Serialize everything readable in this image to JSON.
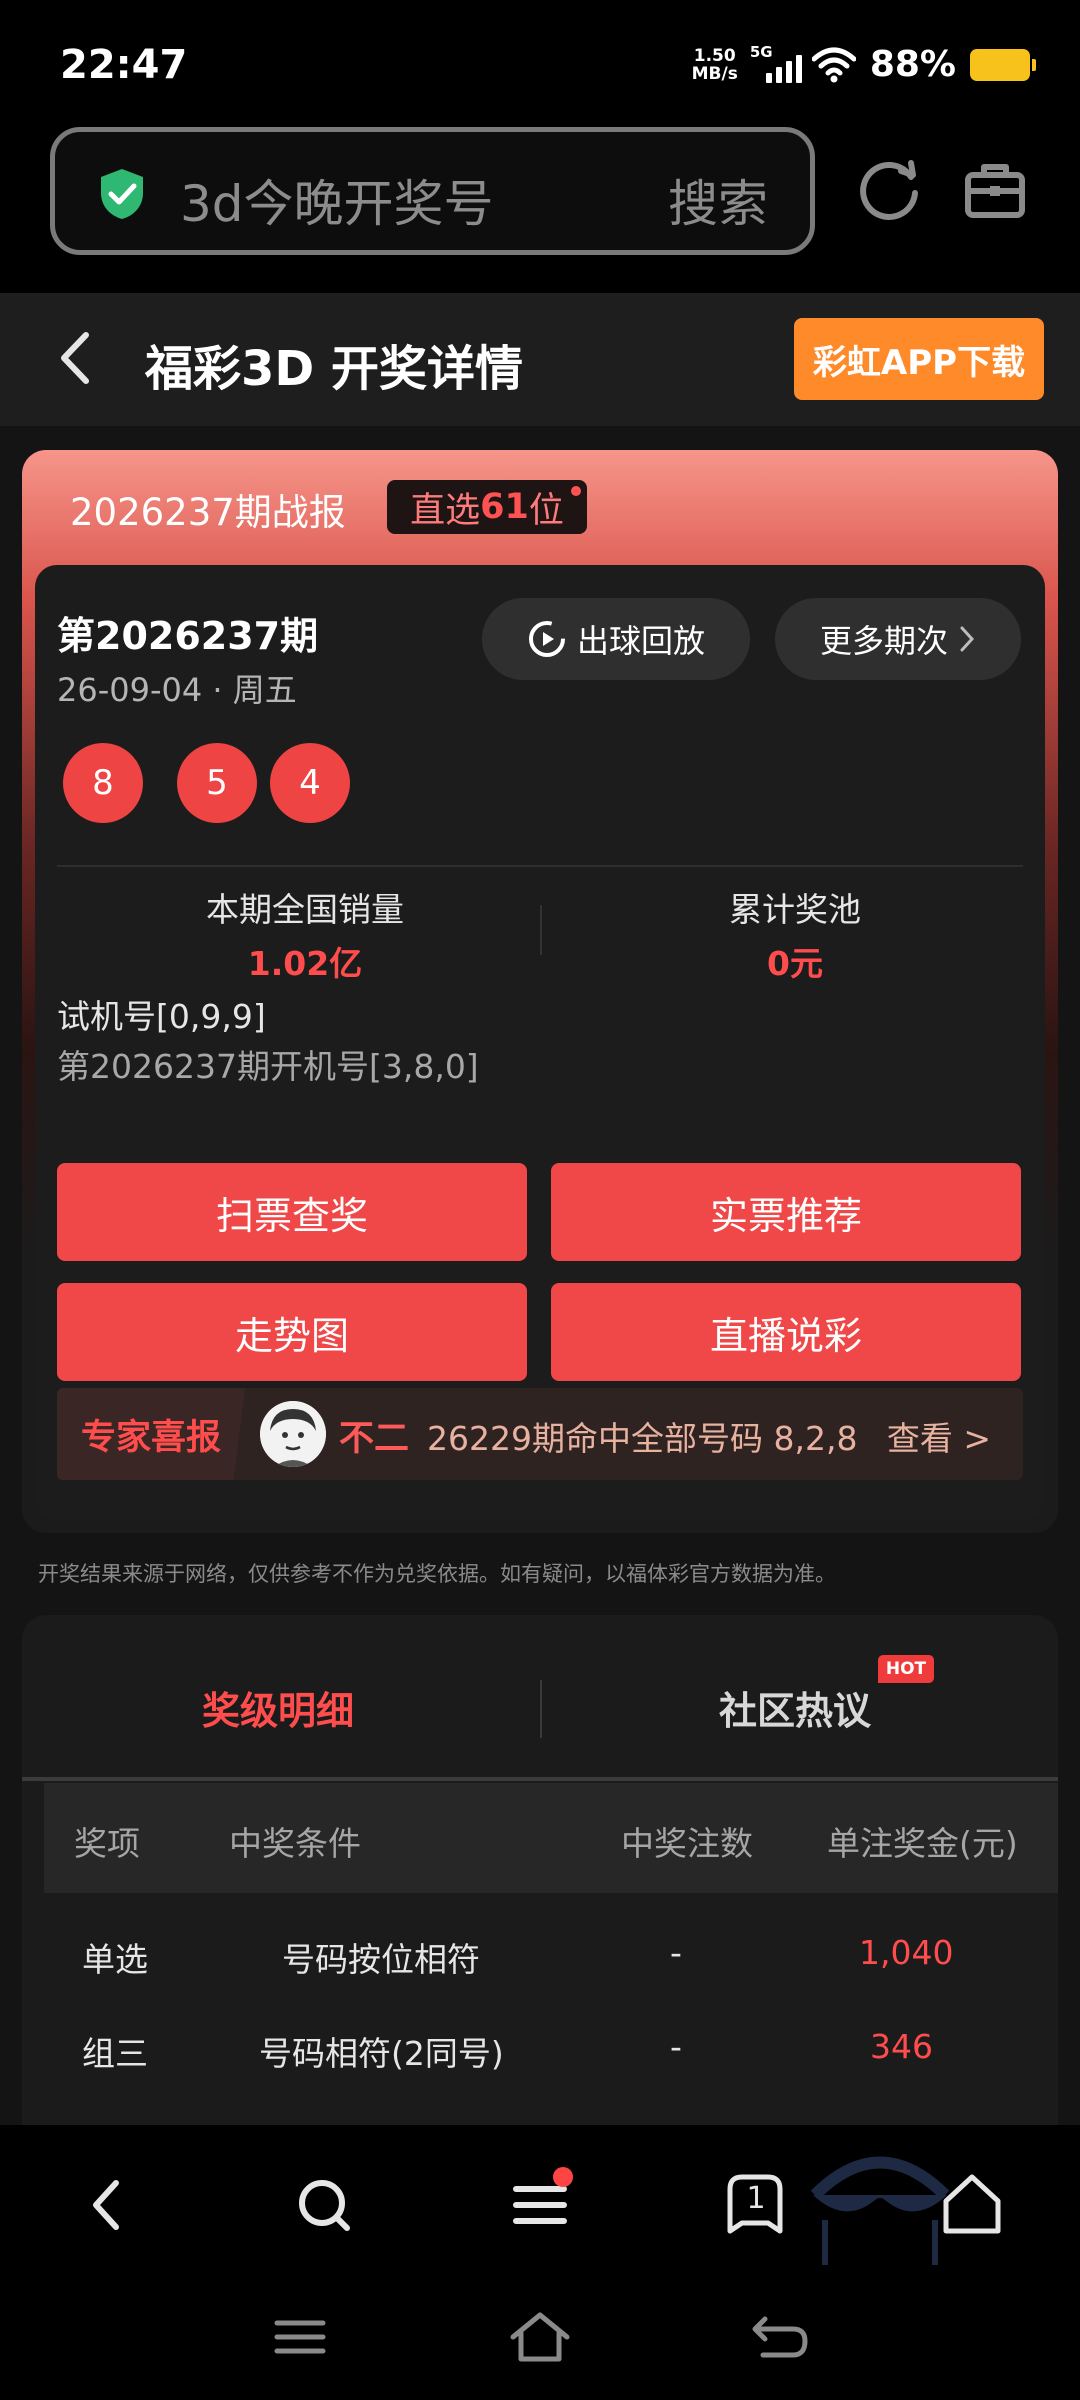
{
  "status_bar": {
    "time": "22:47",
    "net_speed_value": "1.50",
    "net_speed_unit": "MB/s",
    "signal_label": "5G",
    "battery_percent": "88%",
    "battery_color": "#f7c21c"
  },
  "browser": {
    "search_query": "3d今晚开奖号",
    "search_button": "搜索",
    "secure_icon": "shield-check-icon",
    "reload_icon": "reload-icon",
    "toolbox_icon": "toolbox-icon"
  },
  "header": {
    "title": "福彩3D 开奖详情",
    "download_button": "彩虹APP下载",
    "accent_color": "#ff8a2a"
  },
  "report": {
    "title": "2026237期战报",
    "rank_prefix": "直选",
    "rank_number": "61",
    "rank_suffix": "位"
  },
  "draw": {
    "issue": "第2026237期",
    "date": "26-09-04 · 周五",
    "replay_button": "出球回放",
    "more_button": "更多期次",
    "balls": [
      "8",
      "5",
      "4"
    ],
    "sales_label": "本期全国销量",
    "sales_value": "1.02亿",
    "pool_label": "累计奖池",
    "pool_value": "0元",
    "trial_number": "试机号[0,9,9]",
    "open_number": "第2026237期开机号[3,8,0]",
    "ball_color": "#ef4444"
  },
  "actions": {
    "scan": "扫票查奖",
    "recommend": "实票推荐",
    "trend": "走势图",
    "live": "直播说彩"
  },
  "expert": {
    "tag": "专家喜报",
    "name": "不二",
    "text": "26229期命中全部号码 8,2,8",
    "link": "查看 >"
  },
  "disclaimer": "开奖结果来源于网络，仅供参考不作为兑奖依据。如有疑问，以福体彩官方数据为准。",
  "prize": {
    "tab_detail": "奖级明细",
    "tab_community": "社区热议",
    "hot_badge": "HOT",
    "columns": [
      "奖项",
      "中奖条件",
      "中奖注数",
      "单注奖金(元)"
    ],
    "rows": [
      [
        "单选",
        "号码按位相符",
        "-",
        "1,040"
      ],
      [
        "组三",
        "号码相符(2同号)",
        "-",
        "346"
      ]
    ]
  },
  "bottom_nav": {
    "tabs_count": "1"
  }
}
